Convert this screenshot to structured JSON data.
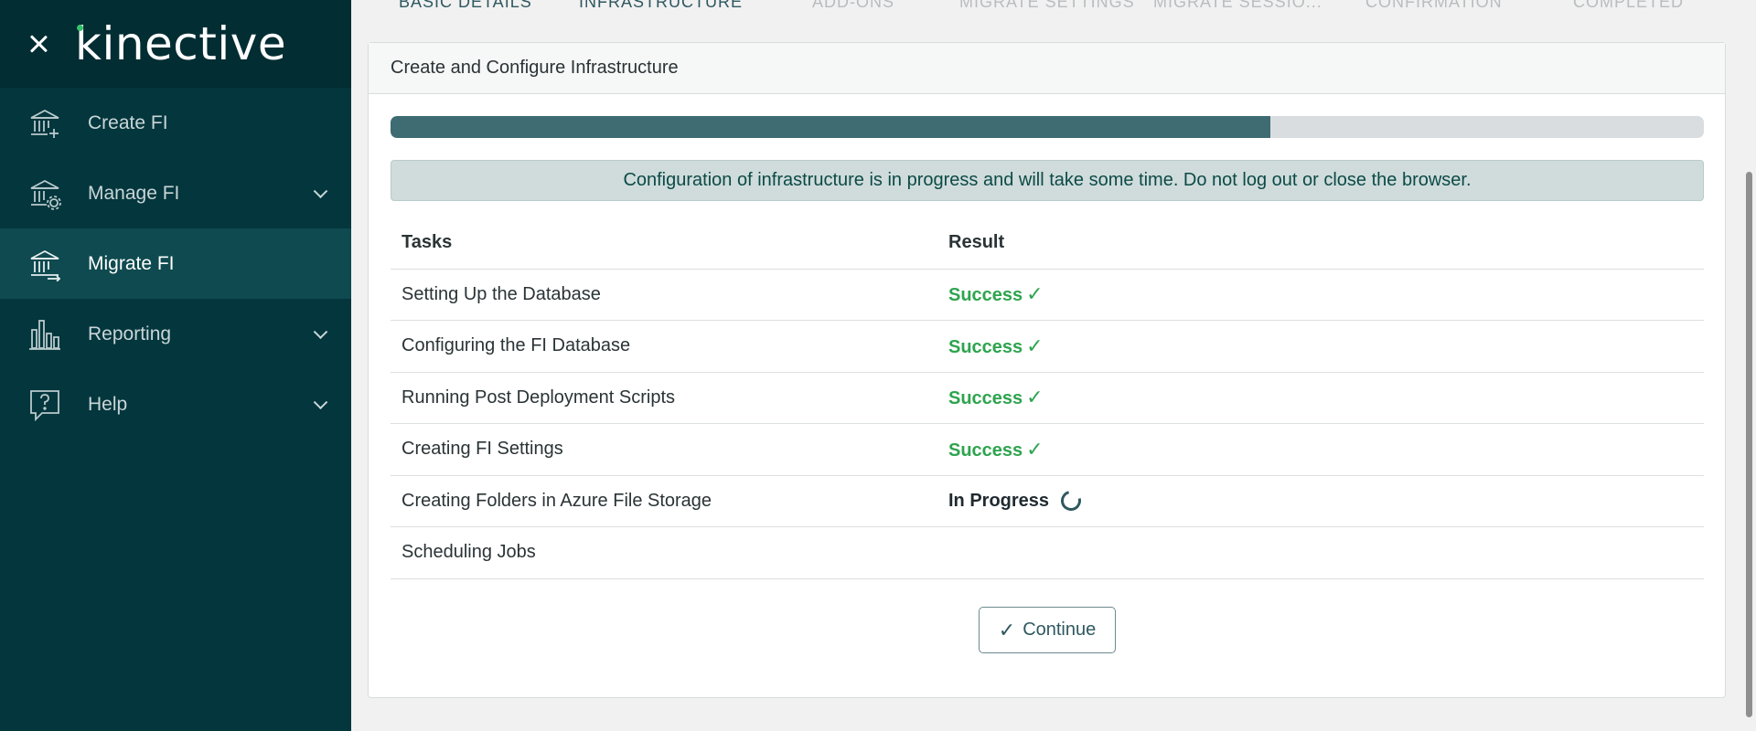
{
  "sidebar": {
    "logo": "kinective",
    "items": [
      {
        "label": "Create FI",
        "icon": "bank-plus-icon",
        "active": false,
        "expandable": false
      },
      {
        "label": "Manage FI",
        "icon": "bank-gear-icon",
        "active": false,
        "expandable": true
      },
      {
        "label": "Migrate FI",
        "icon": "bank-arrow-icon",
        "active": true,
        "expandable": false
      },
      {
        "label": "Reporting",
        "icon": "bar-chart-icon",
        "active": false,
        "expandable": true
      },
      {
        "label": "Help",
        "icon": "help-bubble-icon",
        "active": false,
        "expandable": true
      }
    ]
  },
  "steps": [
    {
      "label": "BASIC DETAILS",
      "state": "done"
    },
    {
      "label": "INFRASTRUCTURE",
      "state": "current"
    },
    {
      "label": "ADD-ONS",
      "state": "pending"
    },
    {
      "label": "MIGRATE SETTINGS",
      "state": "pending"
    },
    {
      "label": "MIGRATE SESSIO...",
      "state": "pending"
    },
    {
      "label": "CONFIRMATION",
      "state": "pending"
    },
    {
      "label": "COMPLETED",
      "state": "pending"
    }
  ],
  "card": {
    "title": "Create and Configure Infrastructure",
    "progress": 0.67,
    "alert": "Configuration of infrastructure is in progress and will take some time. Do not log out or close the browser.",
    "columns": {
      "task": "Tasks",
      "result": "Result"
    },
    "tasks": [
      {
        "name": "Setting Up the Database",
        "result": "Success",
        "status": "success"
      },
      {
        "name": "Configuring the FI Database",
        "result": "Success",
        "status": "success"
      },
      {
        "name": "Running Post Deployment Scripts",
        "result": "Success",
        "status": "success"
      },
      {
        "name": "Creating FI Settings",
        "result": "Success",
        "status": "success"
      },
      {
        "name": "Creating Folders in Azure File Storage",
        "result": "In Progress",
        "status": "in-progress"
      },
      {
        "name": "Scheduling Jobs",
        "result": "",
        "status": "pending"
      }
    ],
    "continue_label": "Continue",
    "check_glyph": "✓"
  },
  "colors": {
    "sidebar_bg": "#03363d",
    "active_item_bg": "#0e4a4f",
    "success": "#2ea44f",
    "progress_fill": "#3f6b72",
    "accent": "#35c26b"
  }
}
